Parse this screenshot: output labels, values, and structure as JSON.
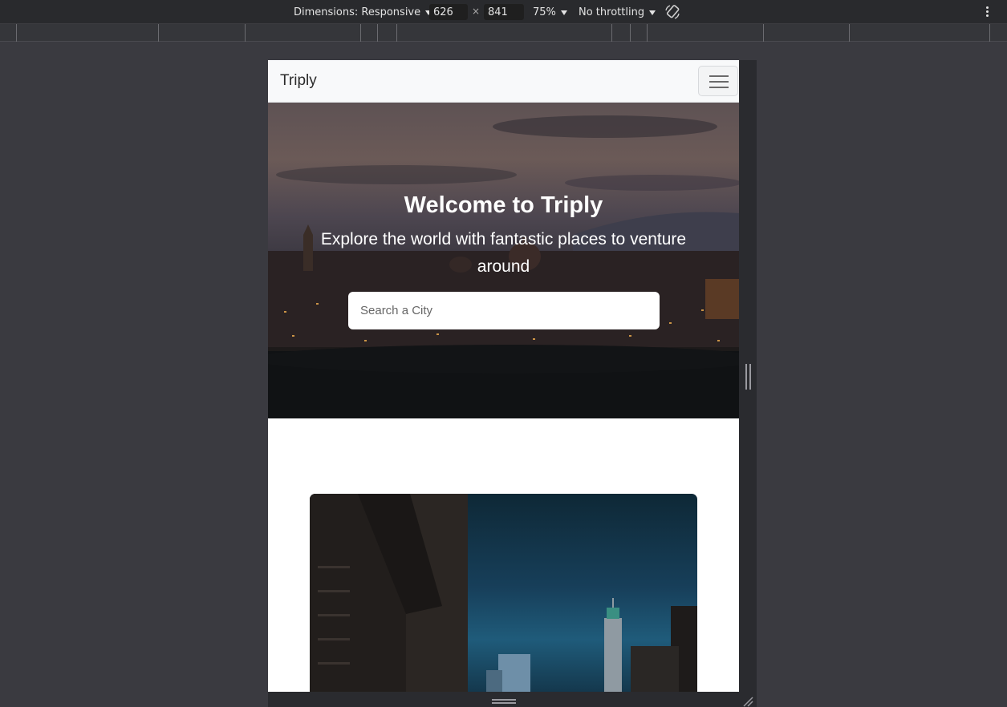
{
  "devtools": {
    "dimensions_label": "Dimensions: Responsive",
    "width": "626",
    "separator": "×",
    "height": "841",
    "zoom": "75%",
    "throttling": "No throttling"
  },
  "navbar": {
    "brand": "Triply"
  },
  "hero": {
    "title": "Welcome to Triply",
    "subtitle": "Explore the world with fantastic places to venture around",
    "search_placeholder": "Search a City"
  },
  "colors": {
    "navbar_bg": "#f8f9fa",
    "devtools_bg": "#292a2d",
    "page_bg": "#ffffff"
  }
}
